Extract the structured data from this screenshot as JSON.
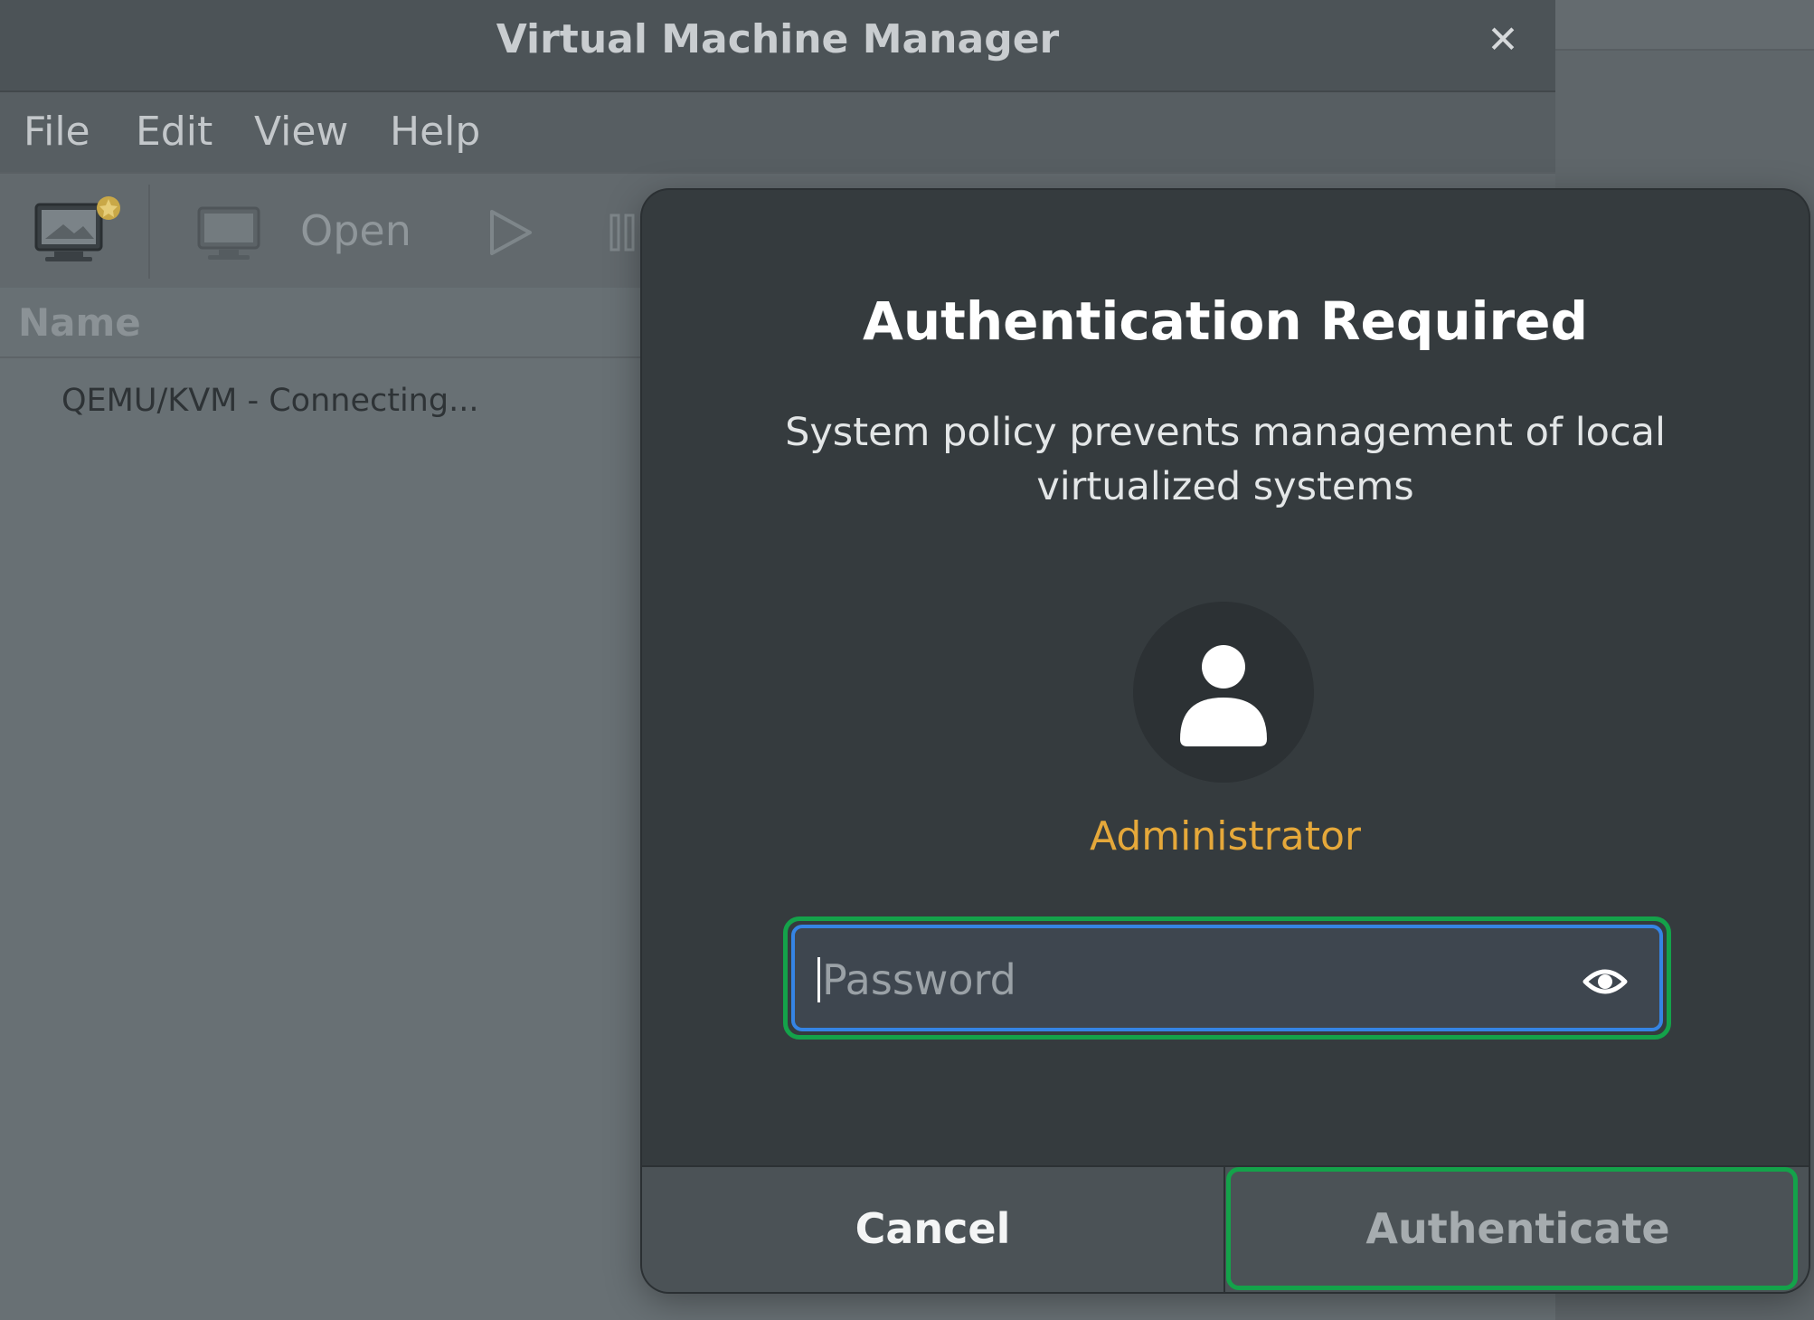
{
  "window": {
    "title": "Virtual Machine Manager",
    "close_symbol": "✕"
  },
  "menu": [
    "File",
    "Edit",
    "View",
    "Help"
  ],
  "toolbar": {
    "new_vm_icon": "new-vm-icon",
    "open_label": "Open",
    "run_icon": "play-icon",
    "pause_icon": "pause-icon"
  },
  "vm_list": {
    "header": "Name",
    "rows": [
      {
        "label": "QEMU/KVM - Connecting..."
      }
    ]
  },
  "dialog": {
    "title": "Authentication Required",
    "message": "System policy prevents management of local virtualized systems",
    "avatar_icon": "user-avatar-icon",
    "user_name": "Administrator",
    "password_placeholder": "Password",
    "reveal_icon": "eye-icon",
    "cancel_label": "Cancel",
    "authenticate_label": "Authenticate"
  },
  "colors": {
    "dialog_bg": "#353b3e",
    "user_name": "#e5a83a",
    "focus_border": "#3584e4",
    "highlight_outline": "#14a24a"
  }
}
